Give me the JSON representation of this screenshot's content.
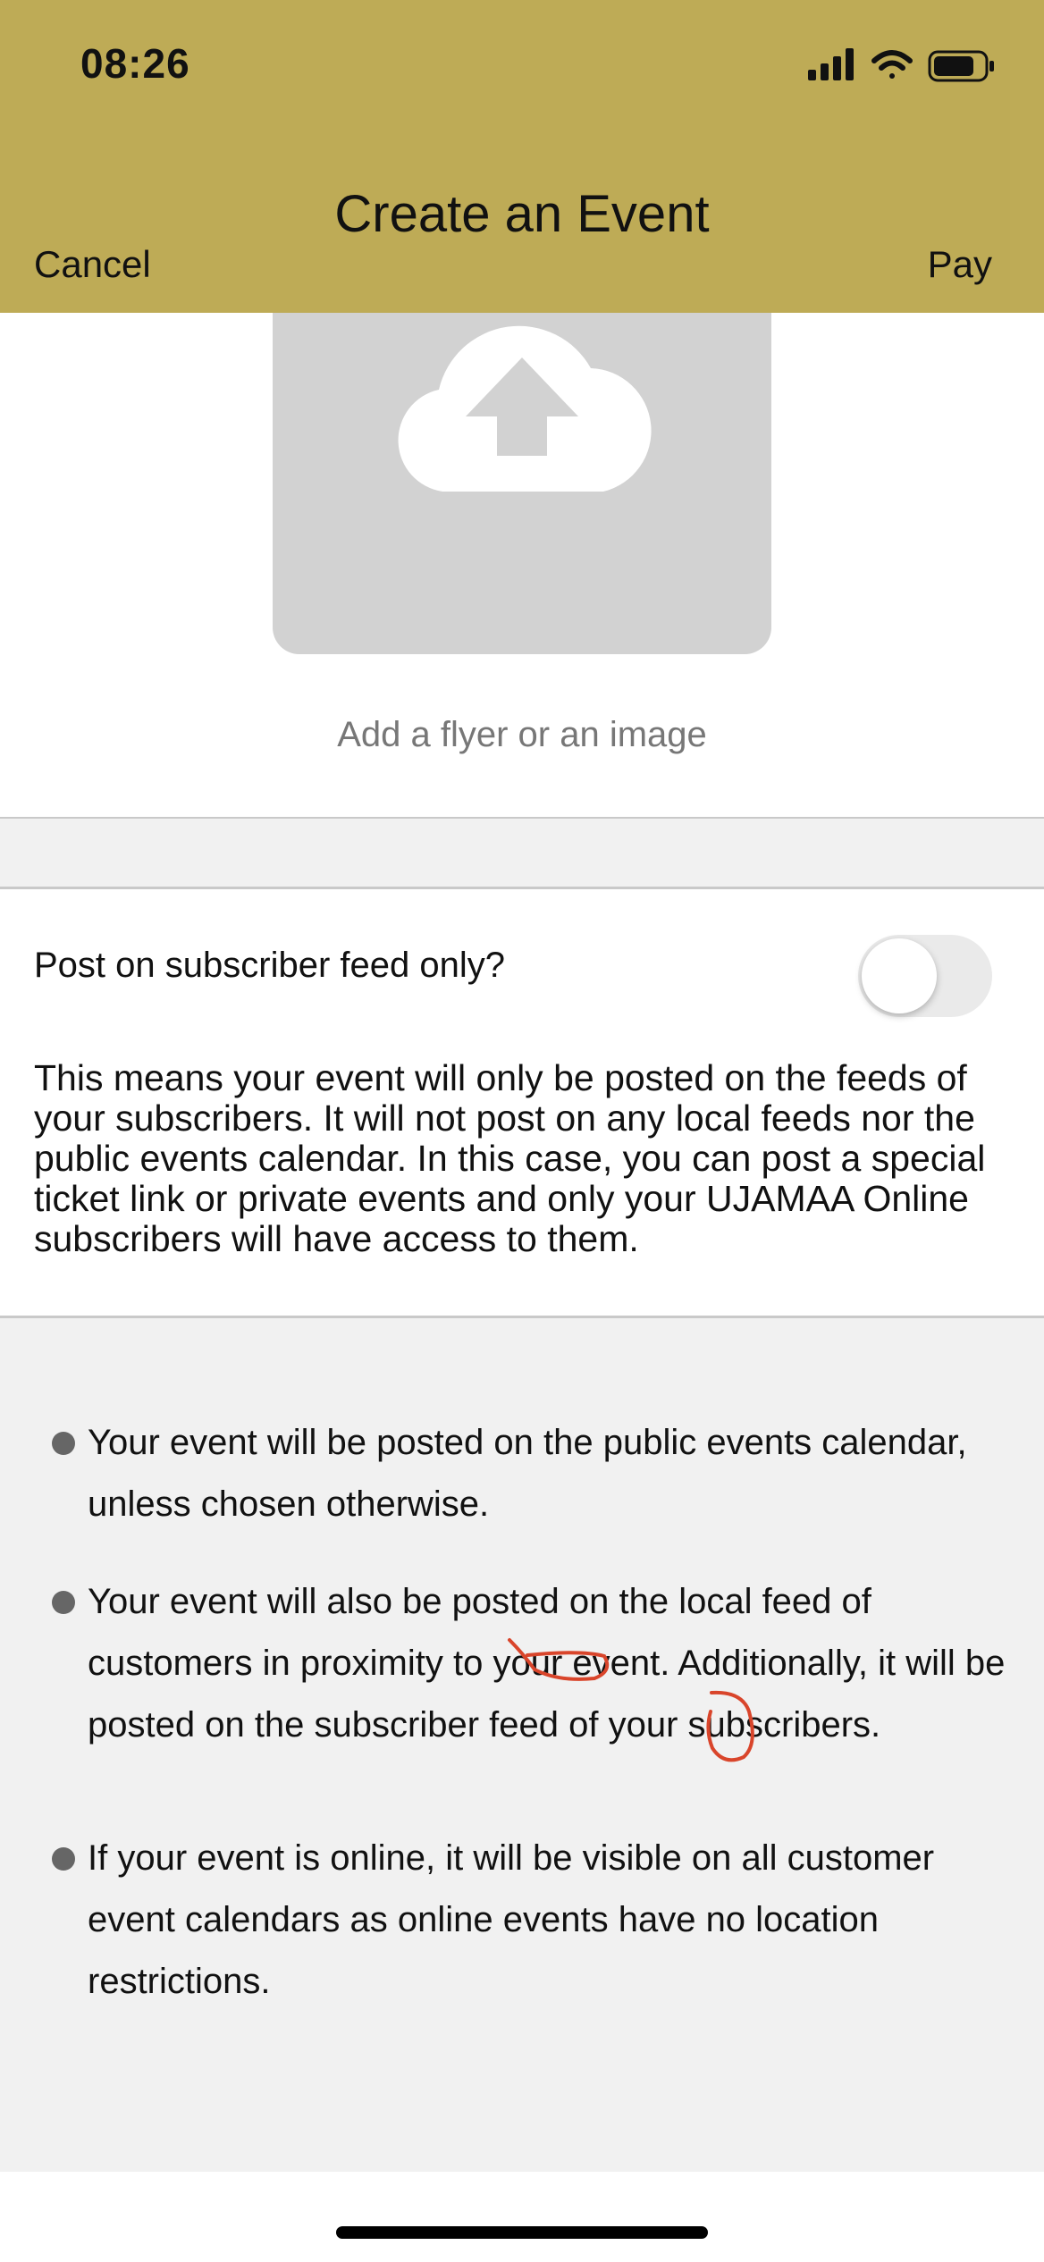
{
  "status_bar": {
    "time": "08:26"
  },
  "nav": {
    "title": "Create an Event",
    "cancel_label": "Cancel",
    "pay_label": "Pay"
  },
  "upload": {
    "caption": "Add a flyer or an image",
    "icon": "cloud-upload-icon"
  },
  "subscriber_toggle": {
    "label": "Post on subscriber feed only?",
    "enabled": false,
    "description": "This means your event will only be posted on the feeds of your subscribers. It will not post on any local feeds nor the public events calendar. In this case, you can post a special ticket link or private events and only your UJAMAA Online subscribers will have access to them."
  },
  "notes": [
    "Your event will be posted on the public events calendar, unless chosen otherwise.",
    "Your event will also be posted on the local feed of customers in proximity to your event. Additionally, it will be posted on the subscriber feed of your subscribers.",
    "If your event is online, it will be visible on all customer event calendars as online events have no location restrictions."
  ],
  "colors": {
    "header": "#BEAB56",
    "panel": "#F1F1F1",
    "annotation": "#D9452B"
  }
}
